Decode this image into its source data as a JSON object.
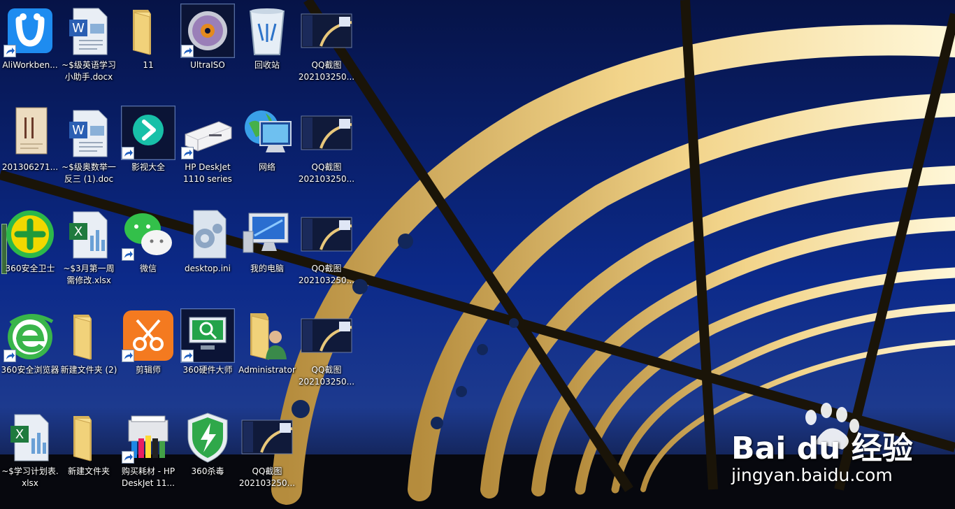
{
  "desktop": {
    "icons": [
      {
        "label": "AliWorkben...",
        "icon": "aliworkbench-icon",
        "shortcut": true
      },
      {
        "label": "~$级英语学习\n小助手.docx",
        "icon": "word-document-icon",
        "shortcut": false
      },
      {
        "label": "11",
        "icon": "folder-icon",
        "shortcut": false
      },
      {
        "label": "UltraISO",
        "icon": "ultraiso-disc-icon",
        "shortcut": true
      },
      {
        "label": "回收站",
        "icon": "recycle-bin-icon",
        "shortcut": false
      },
      {
        "label": "QQ截图\n202103250...",
        "icon": "image-thumbnail-icon",
        "shortcut": false
      },
      {
        "label": "201306271...",
        "icon": "book-cover-thumbnail-icon",
        "shortcut": false
      },
      {
        "label": "~$级奥数举一\n反三 (1).doc",
        "icon": "word-document-icon",
        "shortcut": false
      },
      {
        "label": "影视大全",
        "icon": "video-player-icon",
        "shortcut": true
      },
      {
        "label": "HP DeskJet\n1110 series",
        "icon": "printer-icon",
        "shortcut": true
      },
      {
        "label": "网络",
        "icon": "network-globe-icon",
        "shortcut": false
      },
      {
        "label": "QQ截图\n202103250...",
        "icon": "image-thumbnail-icon",
        "shortcut": false
      },
      {
        "label": "360安全卫士",
        "icon": "security-guard-icon",
        "shortcut": false
      },
      {
        "label": "~$3月第一周\n需修改.xlsx",
        "icon": "excel-document-icon",
        "shortcut": false
      },
      {
        "label": "微信",
        "icon": "wechat-icon",
        "shortcut": true
      },
      {
        "label": "desktop.ini",
        "icon": "settings-file-icon",
        "shortcut": false
      },
      {
        "label": "我的电脑",
        "icon": "computer-icon",
        "shortcut": false
      },
      {
        "label": "QQ截图\n202103250...",
        "icon": "image-thumbnail-icon",
        "shortcut": false
      },
      {
        "label": "360安全浏览器",
        "icon": "browser-e-icon",
        "shortcut": true
      },
      {
        "label": "新建文件夹 (2)",
        "icon": "folder-icon",
        "shortcut": false
      },
      {
        "label": "剪辑师",
        "icon": "scissors-editor-icon",
        "shortcut": true
      },
      {
        "label": "360硬件大师",
        "icon": "hardware-monitor-icon",
        "shortcut": true
      },
      {
        "label": "Administrator",
        "icon": "user-folder-icon",
        "shortcut": false
      },
      {
        "label": "QQ截图\n202103250...",
        "icon": "image-thumbnail-icon",
        "shortcut": false
      },
      {
        "label": "~$学习计划表.\nxlsx",
        "icon": "excel-document-icon",
        "shortcut": false
      },
      {
        "label": "新建文件夹",
        "icon": "folder-icon",
        "shortcut": false
      },
      {
        "label": "购买耗材 - HP\nDeskJet 11...",
        "icon": "printer-supplies-icon",
        "shortcut": true
      },
      {
        "label": "360杀毒",
        "icon": "antivirus-shield-icon",
        "shortcut": false
      },
      {
        "label": "QQ截图\n202103250...",
        "icon": "image-thumbnail-icon",
        "shortcut": false
      }
    ]
  },
  "watermark": {
    "brand": "Bai du 经验",
    "url": "jingyan.baidu.com"
  },
  "colors": {
    "sky": "#0a1e6a",
    "frame": "#e8c77a",
    "text": "#ffffff"
  }
}
